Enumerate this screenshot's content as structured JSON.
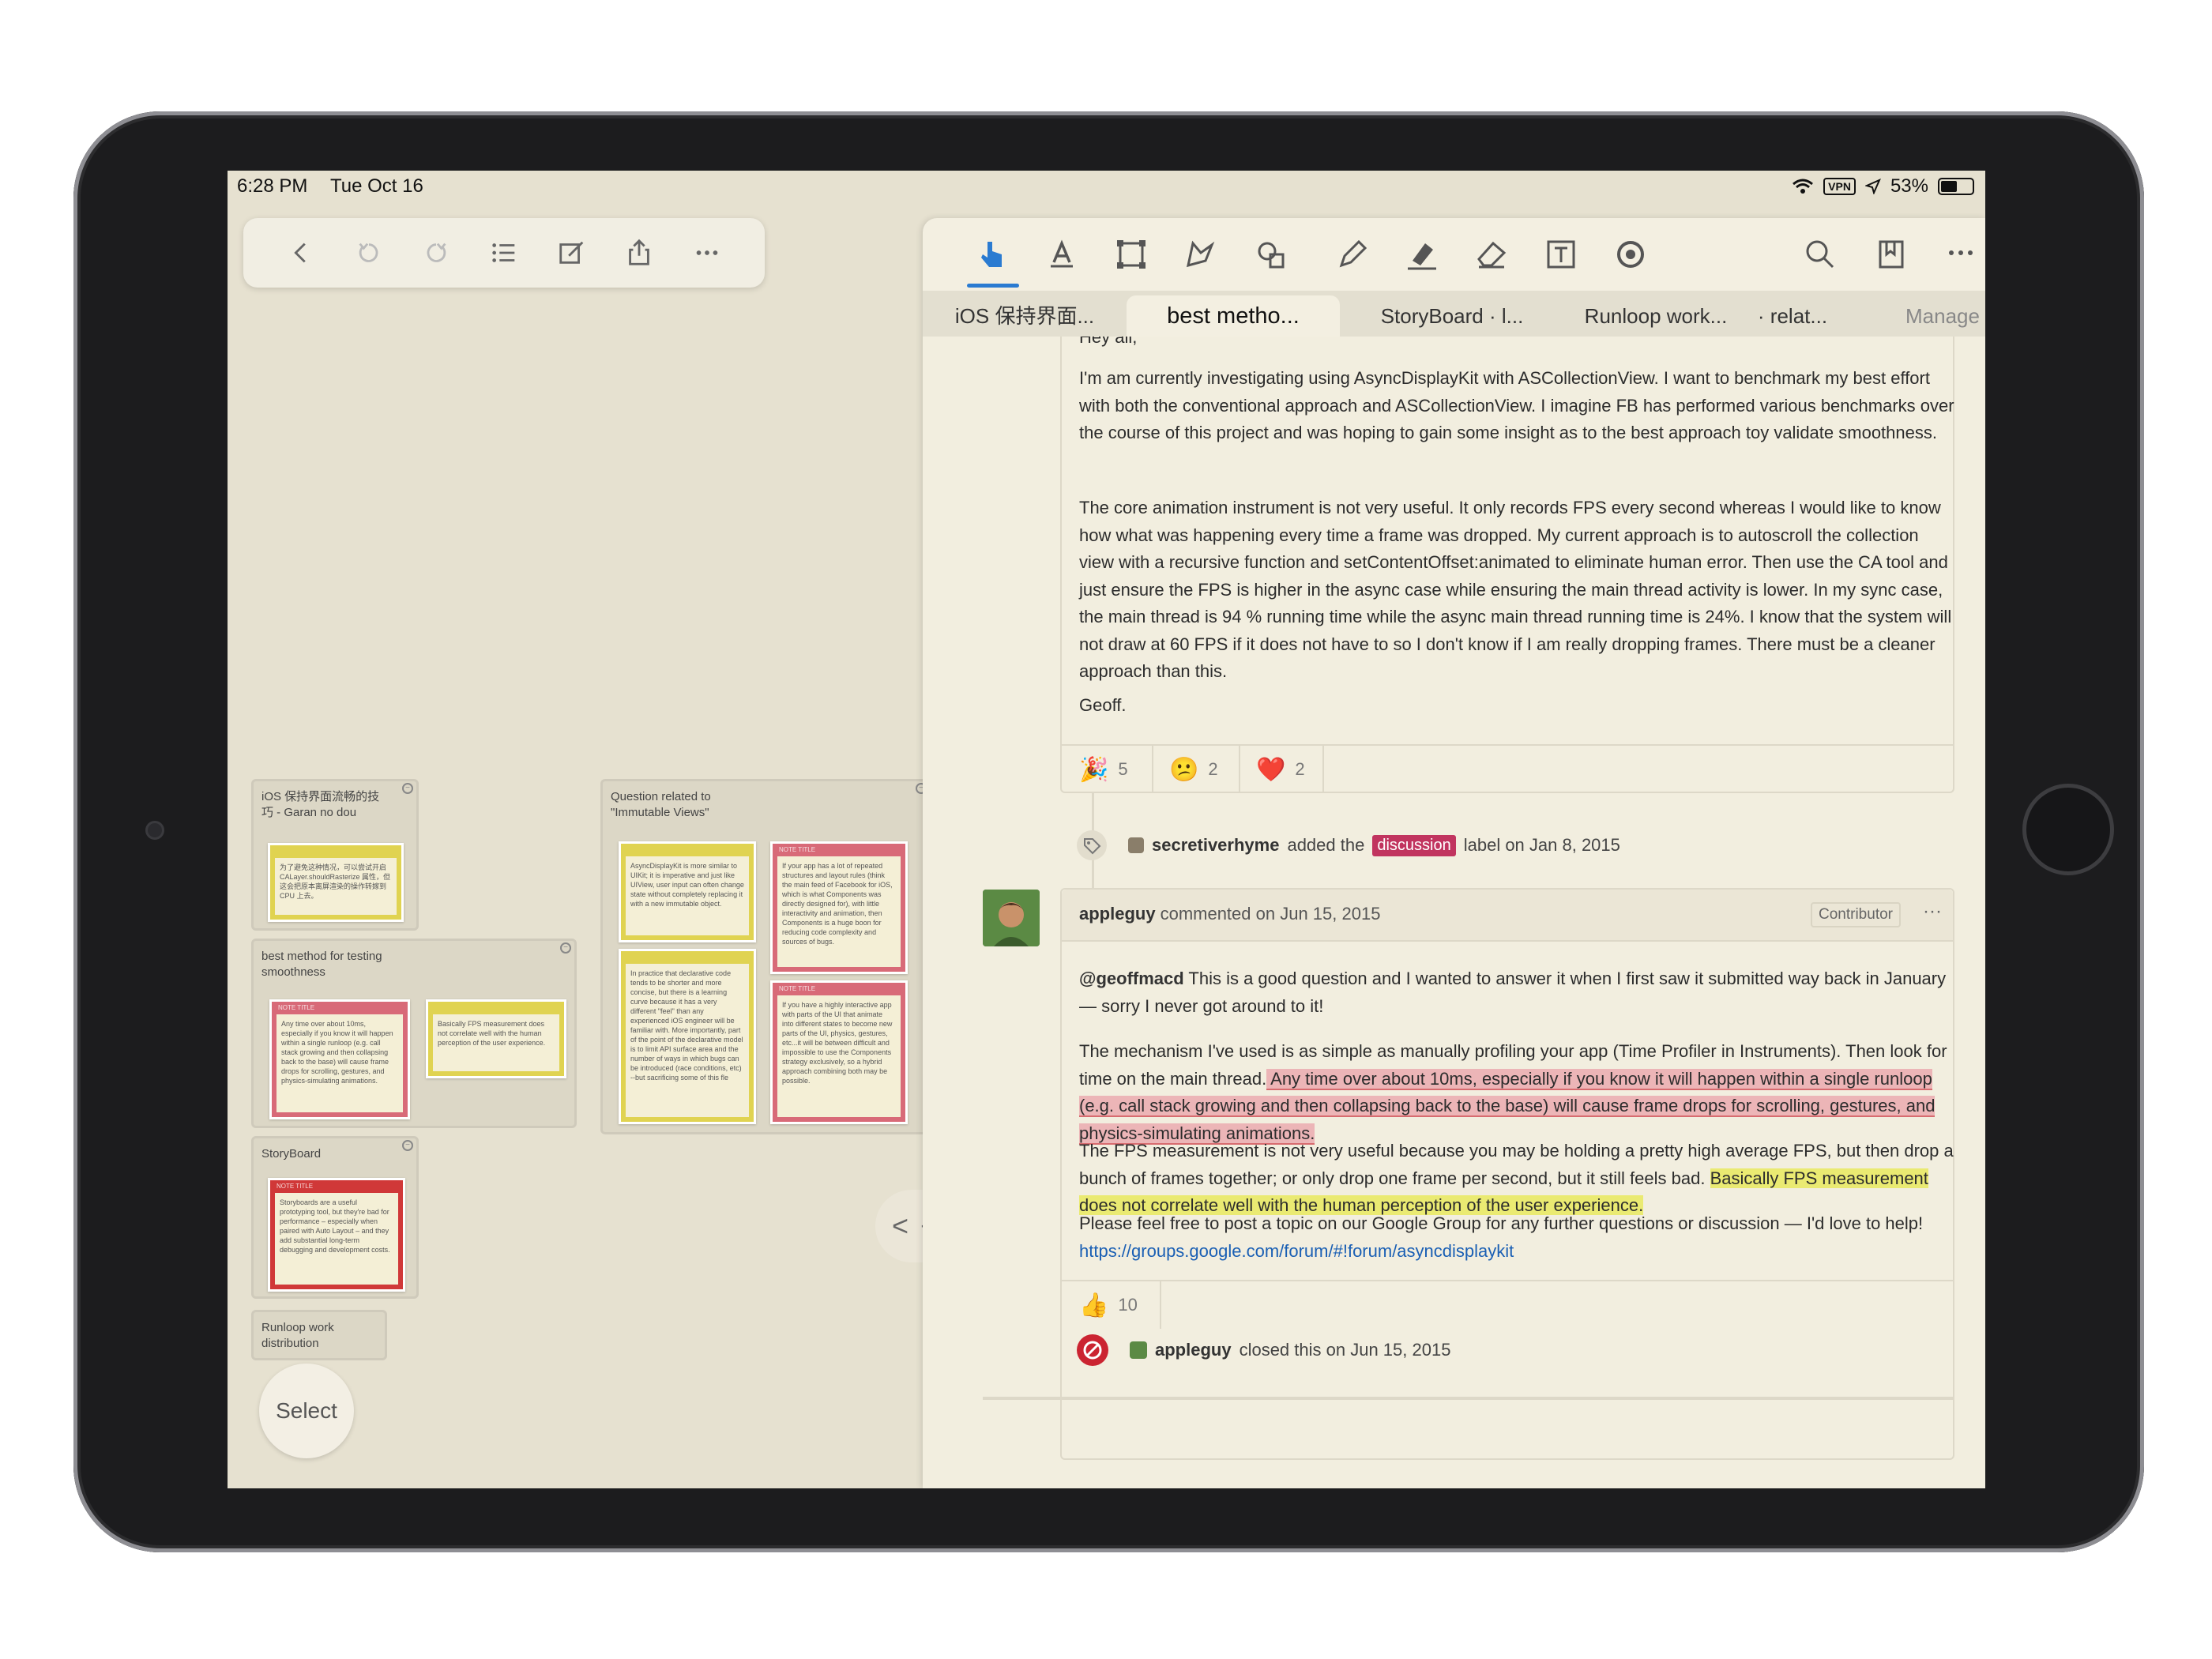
{
  "status": {
    "time": "6:28 PM",
    "date": "Tue Oct 16",
    "vpn": "VPN",
    "battery": "53%",
    "battery_level": 0.53
  },
  "left_toolbar": {
    "icons": [
      "back-icon",
      "undo-icon",
      "redo-icon",
      "list-icon",
      "compose-icon",
      "share-icon",
      "more-icon"
    ]
  },
  "canvas": {
    "groups": [
      {
        "title": "iOS 保持界面流畅的技巧 - Garan no dou"
      },
      {
        "title": "Question related to \"Immutable Views\""
      },
      {
        "title": "best method for testing smoothness"
      },
      {
        "title": "StoryBoard"
      },
      {
        "title": "Runloop work distribution"
      }
    ],
    "notes": [
      {
        "head": "",
        "text": "为了避免这种情况，可以尝试开启 CALayer.shouldRasterize 属性，但这会把原本离屏渲染的操作转嫁到 CPU 上去。"
      },
      {
        "head": "",
        "text": "AsyncDisplayKit is more similar to UIKit; it is imperative and just like UIView, user input can often change state without completely replacing it with a new immutable object."
      },
      {
        "head": "NOTE TITLE",
        "text": "If your app has a lot of repeated structures and layout rules (think the main feed of Facebook for iOS, which is what Components was directly designed for), with little interactivity and animation, then Components is a huge boon for reducing code complexity and sources of bugs."
      },
      {
        "head": "",
        "text": "In practice that declarative code tends to be shorter and more concise, but there is a learning curve because it has a very different \"feel\" than any experienced iOS engineer will be familiar with. More importantly, part of the point of the declarative model is to limit API surface area and the number of ways in which bugs can be introduced (race conditions, etc) --but sacrificing some of this fle"
      },
      {
        "head": "NOTE TITLE",
        "text": "If you have a highly interactive app with parts of the UI that animate into different states to become new parts of the UI, physics, gestures, etc...it will be between difficult and impossible to use the Components strategy exclusively, so a hybrid approach combining both may be possible."
      },
      {
        "head": "NOTE TITLE",
        "text": "Any time over about 10ms, especially if you know it will happen within a single runloop (e.g. call stack growing and then collapsing back to the base) will cause frame drops for scrolling, gestures, and physics-simulating animations."
      },
      {
        "head": "",
        "text": "Basically FPS measurement does not correlate well with the human perception of the user experience."
      },
      {
        "head": "NOTE TITLE",
        "text": "Storyboards are a useful prototyping tool, but they're bad for performance – especially when paired with Auto Layout – and they add substantial long-term debugging and development costs."
      }
    ],
    "select_label": "Select",
    "divider_left": "<",
    "divider_dot": "·",
    "divider_right": ">"
  },
  "tabs": [
    {
      "label": "iOS 保持界面..."
    },
    {
      "label": "best metho..."
    },
    {
      "label": "StoryBoard · l..."
    },
    {
      "label": "Runloop work..."
    },
    {
      "label": "· relat..."
    },
    {
      "label": "Manage"
    }
  ],
  "issue": {
    "partial_greeting": "Hey all,",
    "p1": "I'm am currently investigating using AsyncDisplayKit with ASCollectionView. I want to benchmark my best effort with both the conventional approach and ASCollectionView. I imagine FB has performed various benchmarks over the course of this project and was hoping to gain some insight as to the best approach toy validate smoothness.",
    "p2": "The core animation instrument is not very useful. It only records FPS every second whereas I would like to know how what was happening every time a frame was dropped. My current approach is to autoscroll the collection view with a recursive function and setContentOffset:animated to eliminate human error. Then use the CA tool and just ensure the FPS is higher in the async case while ensuring the main thread activity is lower. In my sync case, the main thread is 94 % running time while the async main thread running time is 24%. I know that the system will not draw at 60 FPS if it does not have to so I don't know if I am really dropping frames. There must be a cleaner approach than this.",
    "sign": "Geoff.",
    "reactions": [
      {
        "emoji": "🎉",
        "count": "5"
      },
      {
        "emoji": "😕",
        "count": "2"
      },
      {
        "emoji": "❤️",
        "count": "2"
      }
    ]
  },
  "label_event": {
    "user": "secretiverhyme",
    "action": "added the",
    "label": "discussion",
    "suffix": "label on Jan 8, 2015"
  },
  "comment": {
    "user": "appleguy",
    "meta": "commented on Jun 15, 2015",
    "badge": "Contributor",
    "more": "···",
    "mention": "@geoffmacd",
    "p1_rest": " This is a good question and I wanted to answer it when I first saw it submitted way back in January — sorry I never got around to it!",
    "p2_start": "The mechanism I've used is as simple as manually profiling your app (Time Profiler in Instruments). Then look for time on the main thread.",
    "p2_highlight": " Any time over about 10ms, especially if you know it will happen within a single runloop (e.g. call stack growing and then collapsing back to the base) will cause frame drops for scrolling, gestures, and physics-simulating animations. ",
    "p3_start": "The FPS measurement is not very useful because you may be holding a pretty high average FPS, but then drop a bunch of frames together; or only drop one frame per second, but it still feels bad.",
    "p3_highlight": "Basically FPS measurement does not correlate well with the human perception of the user experience. ",
    "p4_start": "Please feel free to post a topic on our Google Group for any further questions or discussion — I'd love to help! ",
    "p4_link": "https://groups.google.com/forum/#!forum/asyncdisplaykit",
    "reaction": {
      "emoji": "👍",
      "count": "10"
    }
  },
  "close_event": {
    "user": "appleguy",
    "text": "closed this on Jun 15, 2015"
  },
  "colors": {
    "accent": "#2a7bd1",
    "label": "#c1345f",
    "highlight_red": "#ecb5b7",
    "highlight_yellow": "#eaea72",
    "link": "#1a5fb4"
  }
}
